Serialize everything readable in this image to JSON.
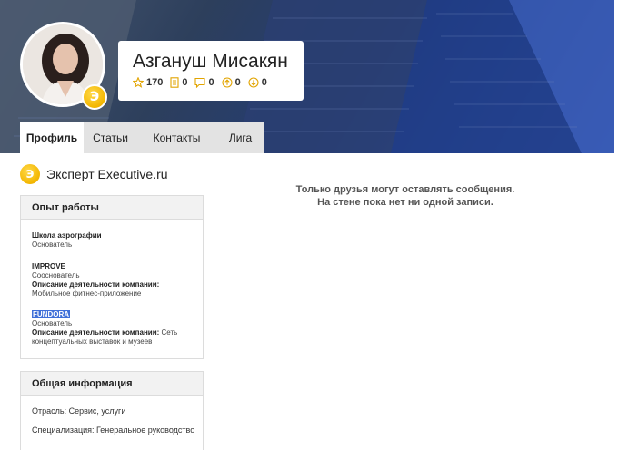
{
  "profile": {
    "name": "Азгануш Мисакян",
    "badge_letter": "Э",
    "stats": [
      {
        "icon": "star-icon",
        "value": "170"
      },
      {
        "icon": "document-icon",
        "value": "0"
      },
      {
        "icon": "comment-icon",
        "value": "0"
      },
      {
        "icon": "arrow-up-icon",
        "value": "0"
      },
      {
        "icon": "arrow-down-icon",
        "value": "0"
      }
    ]
  },
  "tabs": [
    {
      "label": "Профиль",
      "active": true
    },
    {
      "label": "Статьи",
      "active": false
    },
    {
      "label": "Контакты",
      "active": false
    },
    {
      "label": "Лига",
      "active": false
    }
  ],
  "expert": {
    "badge_letter": "Э",
    "label": "Эксперт Executive.ru"
  },
  "wall": {
    "line1": "Только друзья могут оставлять сообщения.",
    "line2": "На стене пока нет ни одной записи."
  },
  "work": {
    "title": "Опыт работы",
    "jobs": [
      {
        "company": "Школа аэрографии",
        "position": "Основатель",
        "desc_label": "",
        "desc": ""
      },
      {
        "company": "IMPROVE",
        "position": "Сооснователь",
        "desc_label": "Описание деятельности компании:",
        "desc": "Мобильное фитнес-приложение"
      },
      {
        "company": "FUNDORA",
        "position": "Основатель",
        "desc_label": "Описание деятельности компании:",
        "desc": " Сеть концептуальных выставок и музеев"
      }
    ]
  },
  "info": {
    "title": "Общая информация",
    "industry": "Отрасль: Сервис, услуги",
    "specialization": "Специализация: Генеральное руководство"
  },
  "colors": {
    "accent_gold": "#f3b600",
    "banner_blue": "#2a4a95",
    "tab_bg": "#e3e3e3",
    "highlight": "#3f6fd8"
  }
}
